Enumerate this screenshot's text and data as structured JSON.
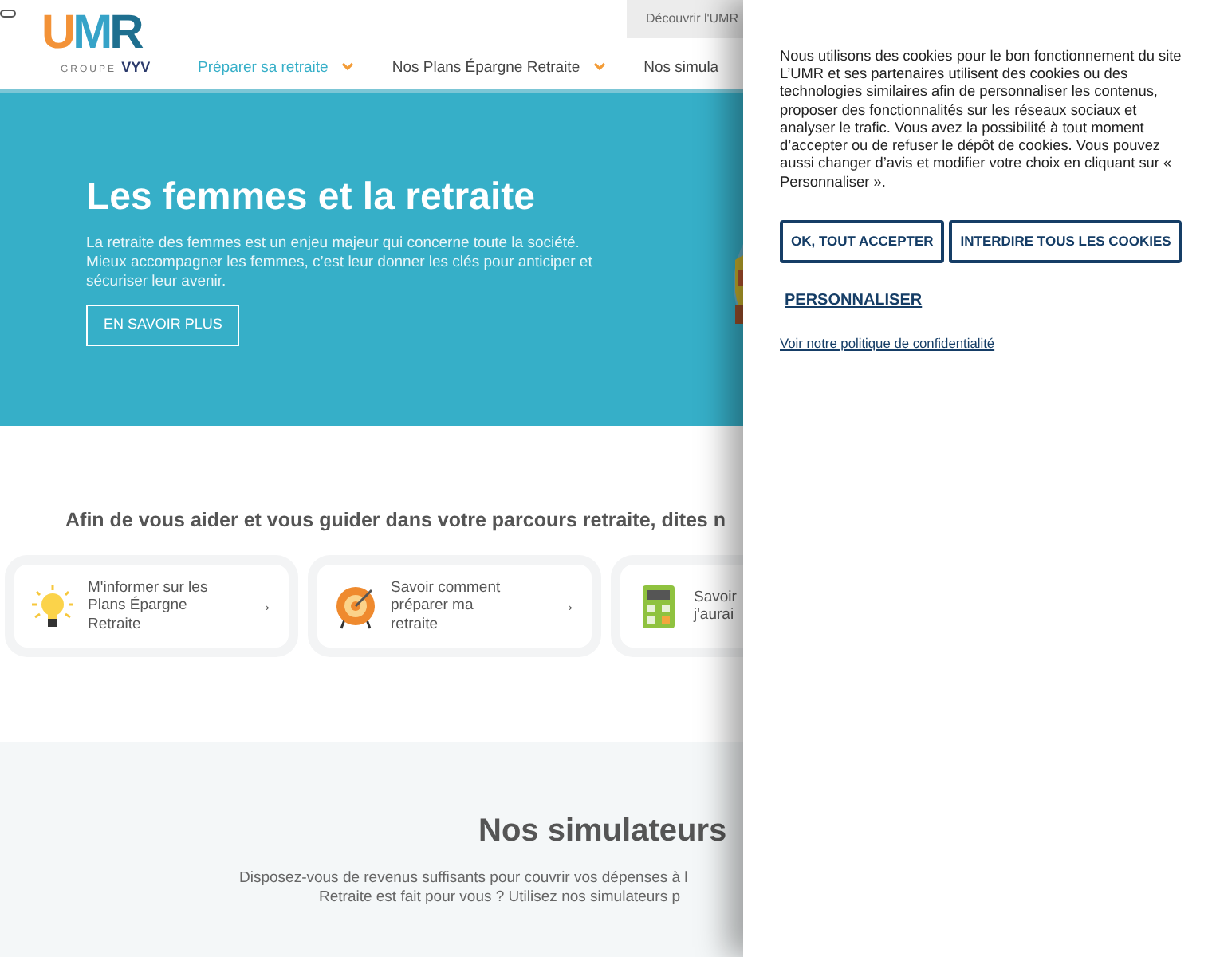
{
  "header": {
    "logo": {
      "brand": "UMR",
      "group_prefix": "GROUPE",
      "group_name": "VYV"
    },
    "top_link": "Découvrir l'UMR",
    "nav": [
      {
        "label": "Préparer sa retraite",
        "selected": true,
        "dropdown": true
      },
      {
        "label": "Nos Plans Épargne Retraite",
        "selected": false,
        "dropdown": true
      },
      {
        "label": "Nos simula",
        "selected": false,
        "dropdown": false
      }
    ]
  },
  "hero": {
    "title": "Les femmes et la retraite",
    "text": "La retraite des femmes est un enjeu majeur qui concerne toute la société. Mieux accompagner les femmes, c’est leur donner les clés pour anticiper et sécuriser leur avenir.",
    "button": "EN SAVOIR PLUS"
  },
  "intro": {
    "heading": "Afin de vous aider et vous guider dans votre parcours retraite, dites n",
    "cards": [
      {
        "kind": "bulb",
        "lines": [
          "M'informer sur les",
          "Plans Épargne",
          "Retraite"
        ],
        "arrow": "→"
      },
      {
        "kind": "target",
        "lines": [
          "Savoir comment",
          "préparer ma",
          "retraite"
        ],
        "arrow": "→"
      },
      {
        "kind": "calculator",
        "lines": [
          "Savoir",
          "j'aurai"
        ]
      }
    ]
  },
  "simulators": {
    "title": "Nos simulateurs",
    "lines": [
      "Disposez-vous de revenus suffisants pour couvrir vos dépenses à l",
      "Retraite est fait pour vous ? Utilisez nos simulateurs p"
    ]
  },
  "cookie_banner": {
    "paragraphs": [
      "Nous utilisons des cookies pour le bon fonctionnement du site",
      "L’UMR et ses partenaires utilisent des cookies ou des technologies similaires afin de personnaliser les contenus, proposer des fonctionnalités sur les réseaux sociaux et analyser le trafic. Vous avez la possibilité à tout moment d’accepter ou de refuser le dépôt de cookies. Vous pouvez aussi changer d’avis et modifier votre choix en cliquant sur « Personnaliser »."
    ],
    "buttons": [
      "OK, TOUT ACCEPTER",
      "INTERDIRE TOUS LES COOKIES"
    ],
    "customize": "PERSONNALISER",
    "policy_link": "Voir notre politique de confidentialité"
  }
}
